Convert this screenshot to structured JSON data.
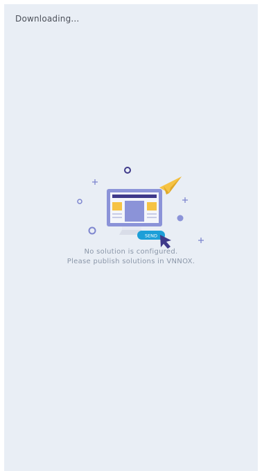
{
  "status": {
    "text": "Downloading..."
  },
  "empty_state": {
    "send_label": "SEND",
    "message_line1": "No solution is configured.",
    "message_line2": "Please publish solutions in VNNOX."
  },
  "colors": {
    "background": "#e9eef5",
    "monitor_frame": "#8b93d8",
    "accent_yellow": "#f6c344",
    "send_pill": "#1d9fd8",
    "cursor": "#3f3a8a",
    "decor": "#7e86cf"
  }
}
